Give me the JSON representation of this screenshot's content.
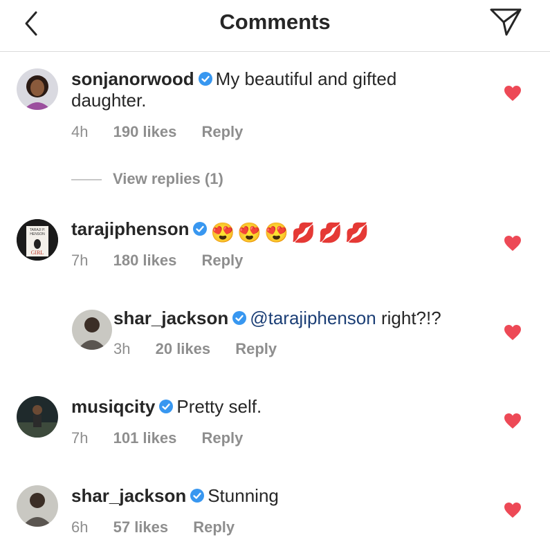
{
  "header": {
    "title": "Comments"
  },
  "comments": [
    {
      "username": "sonjanorwood",
      "text": "My beautiful and gifted",
      "text2": "daughter.",
      "time": "4h",
      "likes": "190 likes",
      "reply": "Reply",
      "view_replies": "View replies (1)"
    },
    {
      "username": "tarajiphenson",
      "text": "😍😍😍💋💋💋",
      "time": "7h",
      "likes": "180 likes",
      "reply": "Reply",
      "avatar_text": [
        "TARAJI P.",
        "HENSON",
        "GIRL"
      ]
    },
    {
      "username": "shar_jackson",
      "mention": "@tarajiphenson",
      "text": " right?!?",
      "time": "3h",
      "likes": "20 likes",
      "reply": "Reply"
    },
    {
      "username": "musiqcity",
      "text": "Pretty self.",
      "time": "7h",
      "likes": "101 likes",
      "reply": "Reply"
    },
    {
      "username": "shar_jackson",
      "text": "Stunning",
      "time": "6h",
      "likes": "57 likes",
      "reply": "Reply"
    }
  ],
  "colors": {
    "heart": "#ed4956",
    "verified": "#3897f0",
    "mention": "#1c3f76",
    "meta": "#8e8e8e"
  },
  "icons": {
    "back": "chevron-left-icon",
    "send": "paper-plane-icon",
    "like": "heart-icon",
    "verified": "verified-badge-icon"
  }
}
